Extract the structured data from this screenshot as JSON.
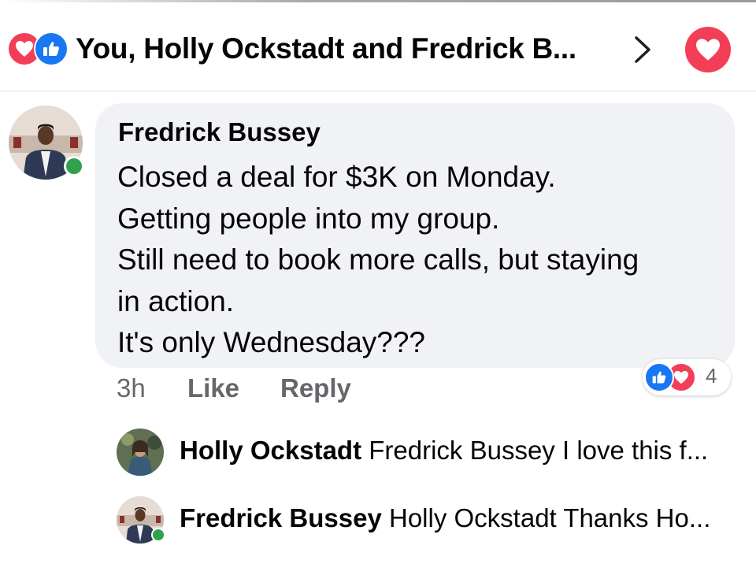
{
  "header": {
    "title": "You, Holly Ockstadt and Fredrick B...",
    "reaction_icons": [
      "love-icon",
      "like-icon"
    ],
    "chevron_icon": "chevron-right-icon",
    "love_button_icon": "heart-icon"
  },
  "comment": {
    "author": "Fredrick Bussey",
    "lines": [
      "Closed a deal for $3K on Monday.",
      "Getting people into my group.",
      "Still need to book more calls, but staying",
      "in action.",
      "It's only Wednesday???"
    ],
    "time": "3h",
    "like_label": "Like",
    "reply_label": "Reply",
    "reaction_count": "4",
    "author_online": true
  },
  "replies": [
    {
      "name": "Holly Ockstadt",
      "preview": "Fredrick Bussey I love this f...",
      "online": false
    },
    {
      "name": "Fredrick Bussey",
      "preview": "Holly Ockstadt Thanks Ho...",
      "online": true
    }
  ],
  "colors": {
    "like_blue": "#1877f2",
    "love_red": "#f33e58",
    "bubble_bg": "#f0f2f5",
    "muted_text": "#65676b",
    "online_green": "#31a24c"
  }
}
